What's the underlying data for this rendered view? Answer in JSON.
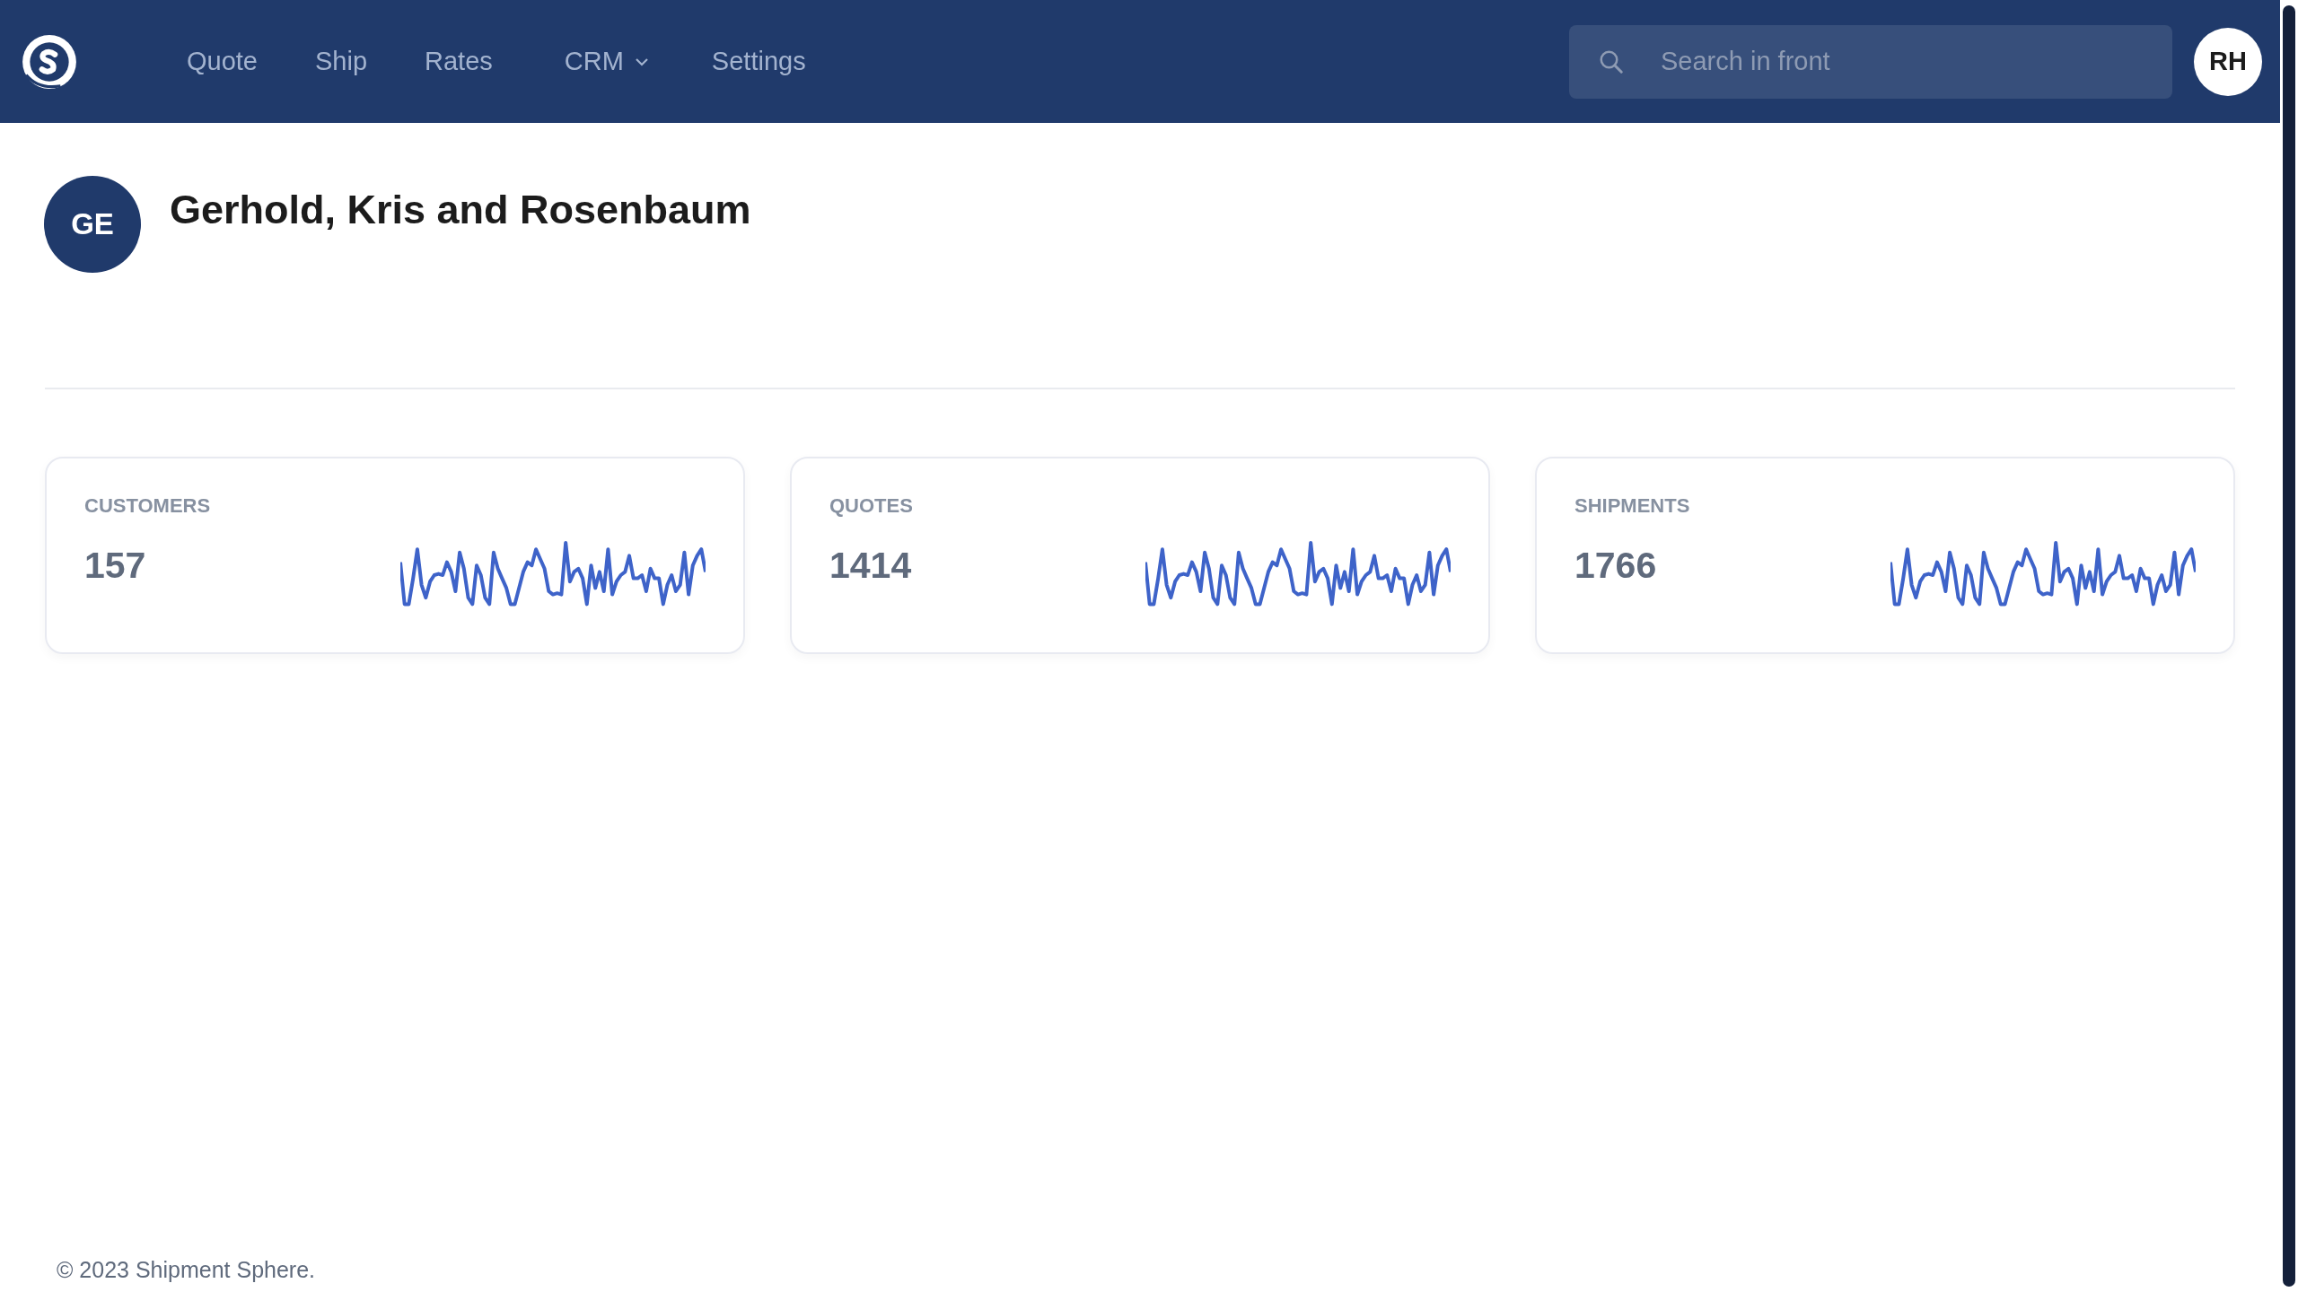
{
  "nav": {
    "items": [
      {
        "label": "Quote",
        "kind": "link"
      },
      {
        "label": "Ship",
        "kind": "link"
      },
      {
        "label": "Rates",
        "kind": "link"
      },
      {
        "label": "CRM",
        "kind": "dropdown"
      },
      {
        "label": "Settings",
        "kind": "link"
      }
    ],
    "search": {
      "placeholder": "Search in front"
    },
    "user_initials": "RH"
  },
  "company": {
    "initials": "GE",
    "name": "Gerhold, Kris and Rosenbaum"
  },
  "stats": [
    {
      "label": "CUSTOMERS",
      "value": "157"
    },
    {
      "label": "QUOTES",
      "value": "1414"
    },
    {
      "label": "SHIPMENTS",
      "value": "1766"
    }
  ],
  "footer": "© 2023 Shipment Sphere."
}
